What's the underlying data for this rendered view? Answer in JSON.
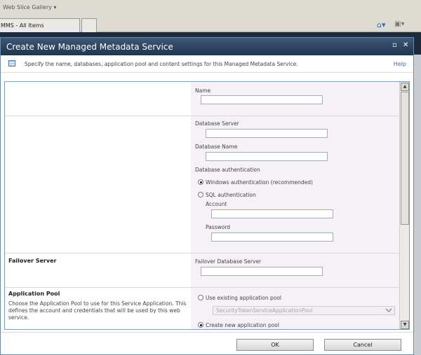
{
  "browser": {
    "favorites_item": "Web Slice Gallery ▾",
    "tab_label": "MMS - All Items"
  },
  "dialog": {
    "title": "Create New Managed Metadata Service",
    "description": "Specify the name, databases, application pool and content settings for this Managed Metadata Service.",
    "help_link": "Help",
    "fields": {
      "name_label": "Name",
      "name_value": "",
      "db_server_label": "Database Server",
      "db_server_value": "",
      "db_name_label": "Database Name",
      "db_name_value": "",
      "db_auth_label": "Database authentication",
      "windows_auth": "Windows authentication (recommended)",
      "sql_auth": "SQL authentication",
      "account_label": "Account",
      "password_label": "Password"
    },
    "failover": {
      "heading": "Failover Server",
      "label": "Failover Database Server",
      "value": ""
    },
    "app_pool": {
      "heading": "Application Pool",
      "description": "Choose the Application Pool to use for this Service Application.  This defines the account and credentials that will be used by this web service.",
      "use_existing": "Use existing application pool",
      "existing_selected": "SecurityTokenServiceApplicationPool",
      "create_new": "Create new application pool"
    },
    "buttons": {
      "ok": "OK",
      "cancel": "Cancel"
    }
  }
}
